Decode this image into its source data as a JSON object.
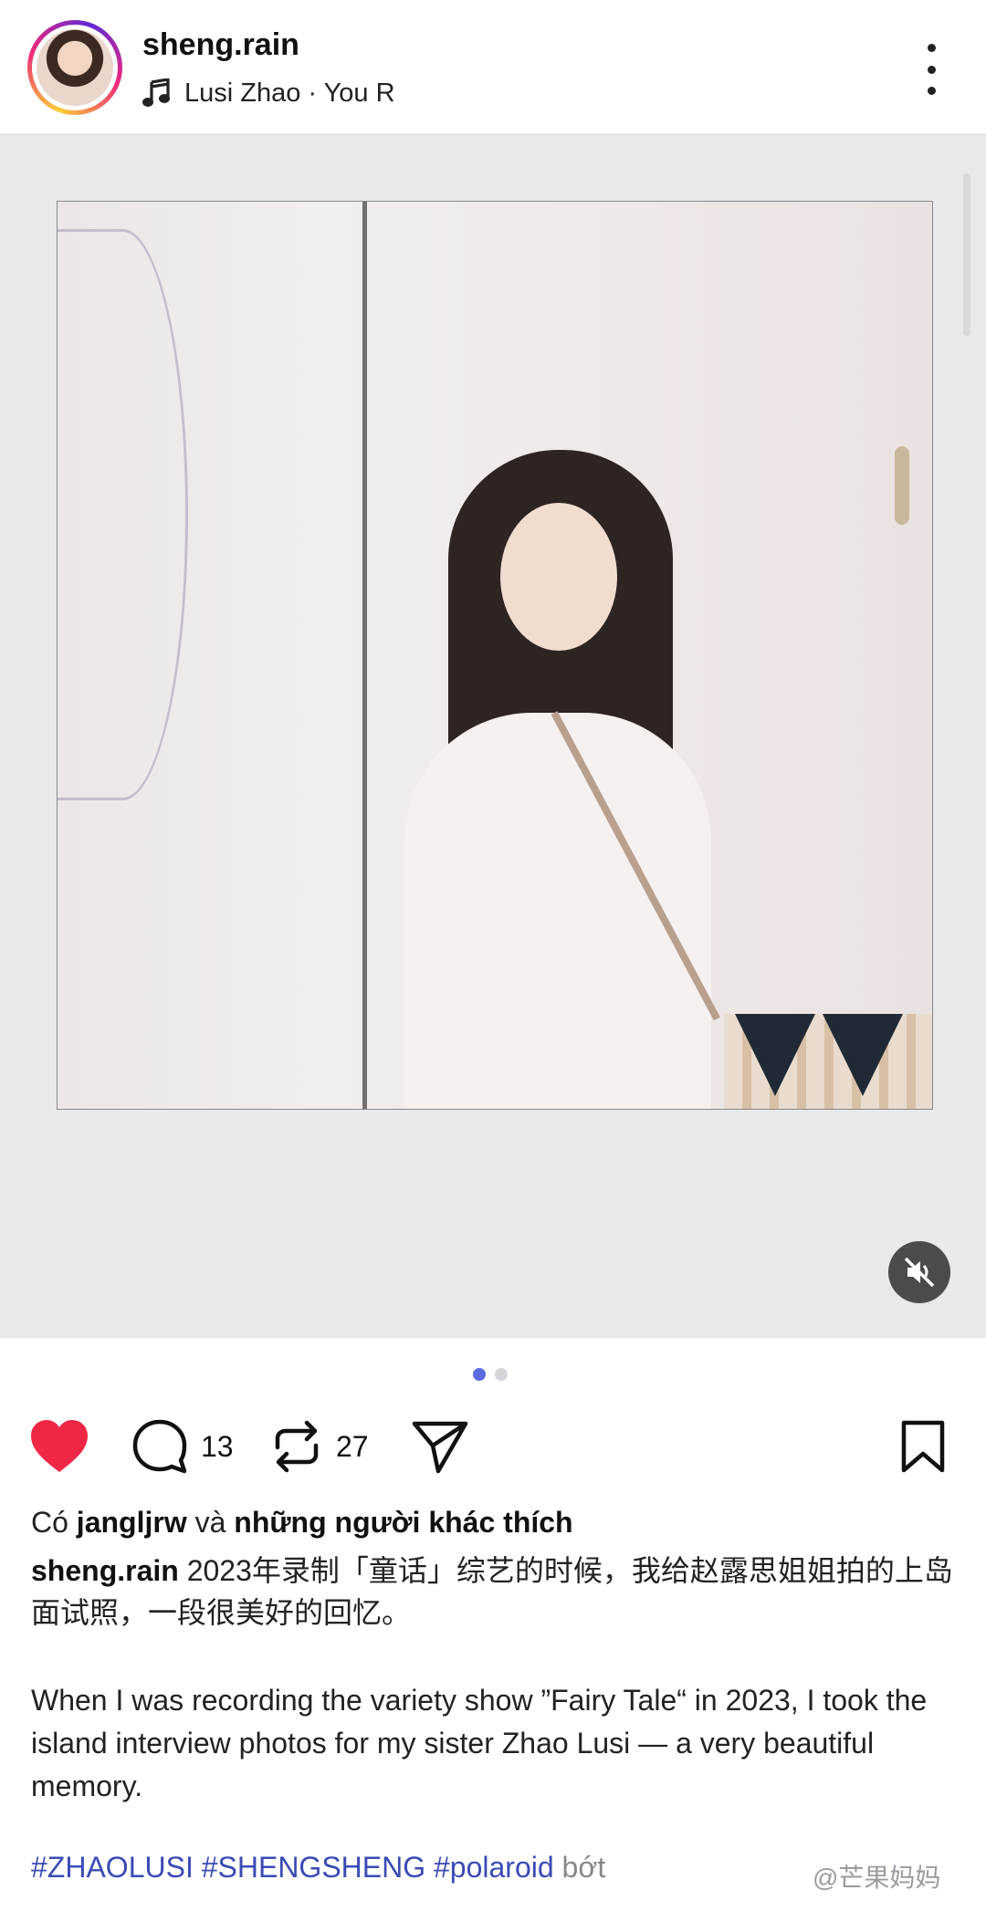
{
  "header": {
    "username": "sheng.rain",
    "music": "Lusi Zhao · You R",
    "music_icon": "music-note-icon",
    "more_icon": "more-vertical-icon"
  },
  "media": {
    "alt": "",
    "mute_icon": "volume-mute-icon",
    "carousel_index": 1,
    "carousel_total": 2
  },
  "actions": {
    "like_icon": "heart-filled-icon",
    "like_color": "#ef2745",
    "comment_icon": "comment-icon",
    "comment_count": "13",
    "repost_icon": "repost-icon",
    "repost_count": "27",
    "share_icon": "send-icon",
    "save_icon": "bookmark-icon"
  },
  "likes": {
    "prefix": "Có",
    "user": "jangljrw",
    "conj": "và",
    "others": "những người khác thích"
  },
  "caption": {
    "user": "sheng.rain",
    "text_zh": "2023年录制「童话」综艺的时候，我给赵露思姐姐拍的上岛面试照，一段很美好的回忆。",
    "text_en": "When I was recording the variety show ”Fairy Tale“ in 2023, I took the island interview photos for my sister Zhao Lusi — a very beautiful memory."
  },
  "tags": {
    "items": [
      "#ZHAOLUSI",
      "#SHENGSHENG",
      "#polaroid"
    ],
    "more": "bớt"
  },
  "watermark": "@芒果妈妈",
  "colors": {
    "accent": "#5a6ae0",
    "hashtag": "#3a4bb5"
  }
}
